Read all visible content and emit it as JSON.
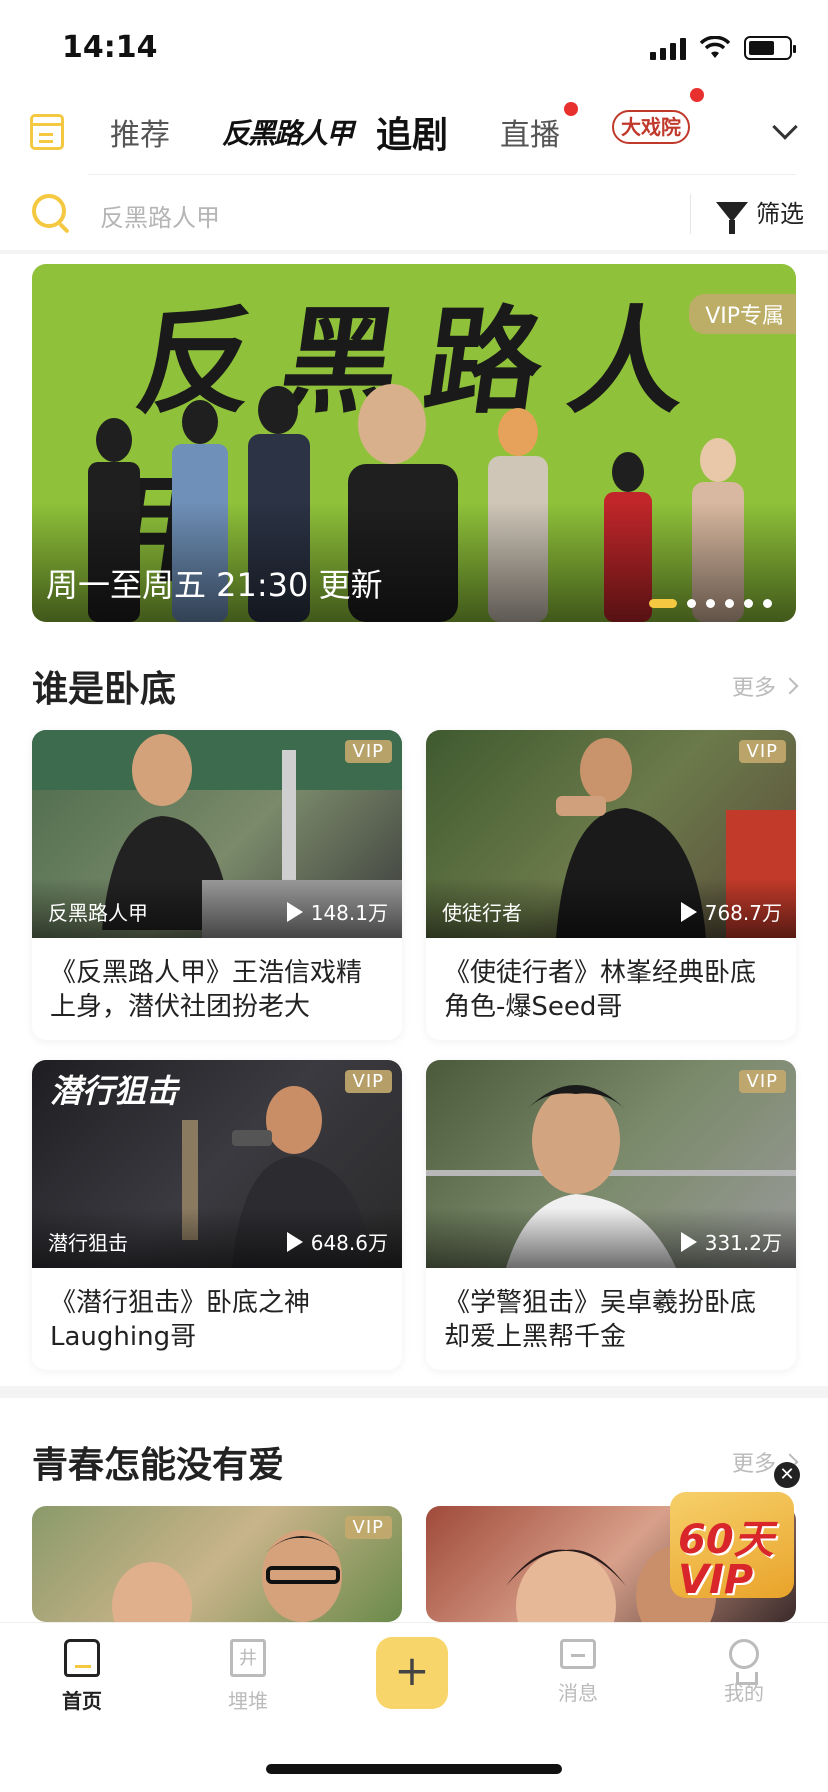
{
  "status": {
    "time": "14:14"
  },
  "top_nav": {
    "tabs": [
      "推荐",
      "反黑路人甲",
      "追剧",
      "直播",
      "大戏院"
    ],
    "active_tab": "追剧"
  },
  "search": {
    "placeholder": "反黑路人甲",
    "filter_label": "筛选"
  },
  "banner": {
    "title_art": "反黑路人甲",
    "caption": "周一至周五 21:30 更新",
    "badge": "VIP专属",
    "slide_count": 6,
    "active_slide": 1
  },
  "section1": {
    "title": "谁是卧底",
    "more": "更多",
    "cards": [
      {
        "show": "反黑路人甲",
        "views": "148.1万",
        "badge": "VIP",
        "title": "《反黑路人甲》王浩信戏精上身，潜伏社团扮老大"
      },
      {
        "show": "使徒行者",
        "views": "768.7万",
        "badge": "VIP",
        "title": "《使徒行者》林峯经典卧底角色-爆Seed哥"
      },
      {
        "show": "潜行狙击",
        "views": "648.6万",
        "badge": "VIP",
        "title": "《潜行狙击》卧底之神Laughing哥"
      },
      {
        "show": "",
        "views": "331.2万",
        "badge": "VIP",
        "title": "《学警狙击》吴卓羲扮卧底却爱上黑帮千金"
      }
    ]
  },
  "section2": {
    "title": "青春怎能没有爱",
    "more": "更多",
    "cards": [
      {
        "badge": "VIP"
      }
    ]
  },
  "promo": {
    "text": "60天VIP",
    "close": "✕"
  },
  "tab_bar": {
    "home": "首页",
    "bookshelf": "埋堆",
    "plus": "+",
    "messages": "消息",
    "me": "我的"
  },
  "colors": {
    "accent": "#f5c842",
    "vip": "#c4aa6e",
    "banner_bg": "#8fc23a",
    "dot_red": "#e8312f"
  }
}
